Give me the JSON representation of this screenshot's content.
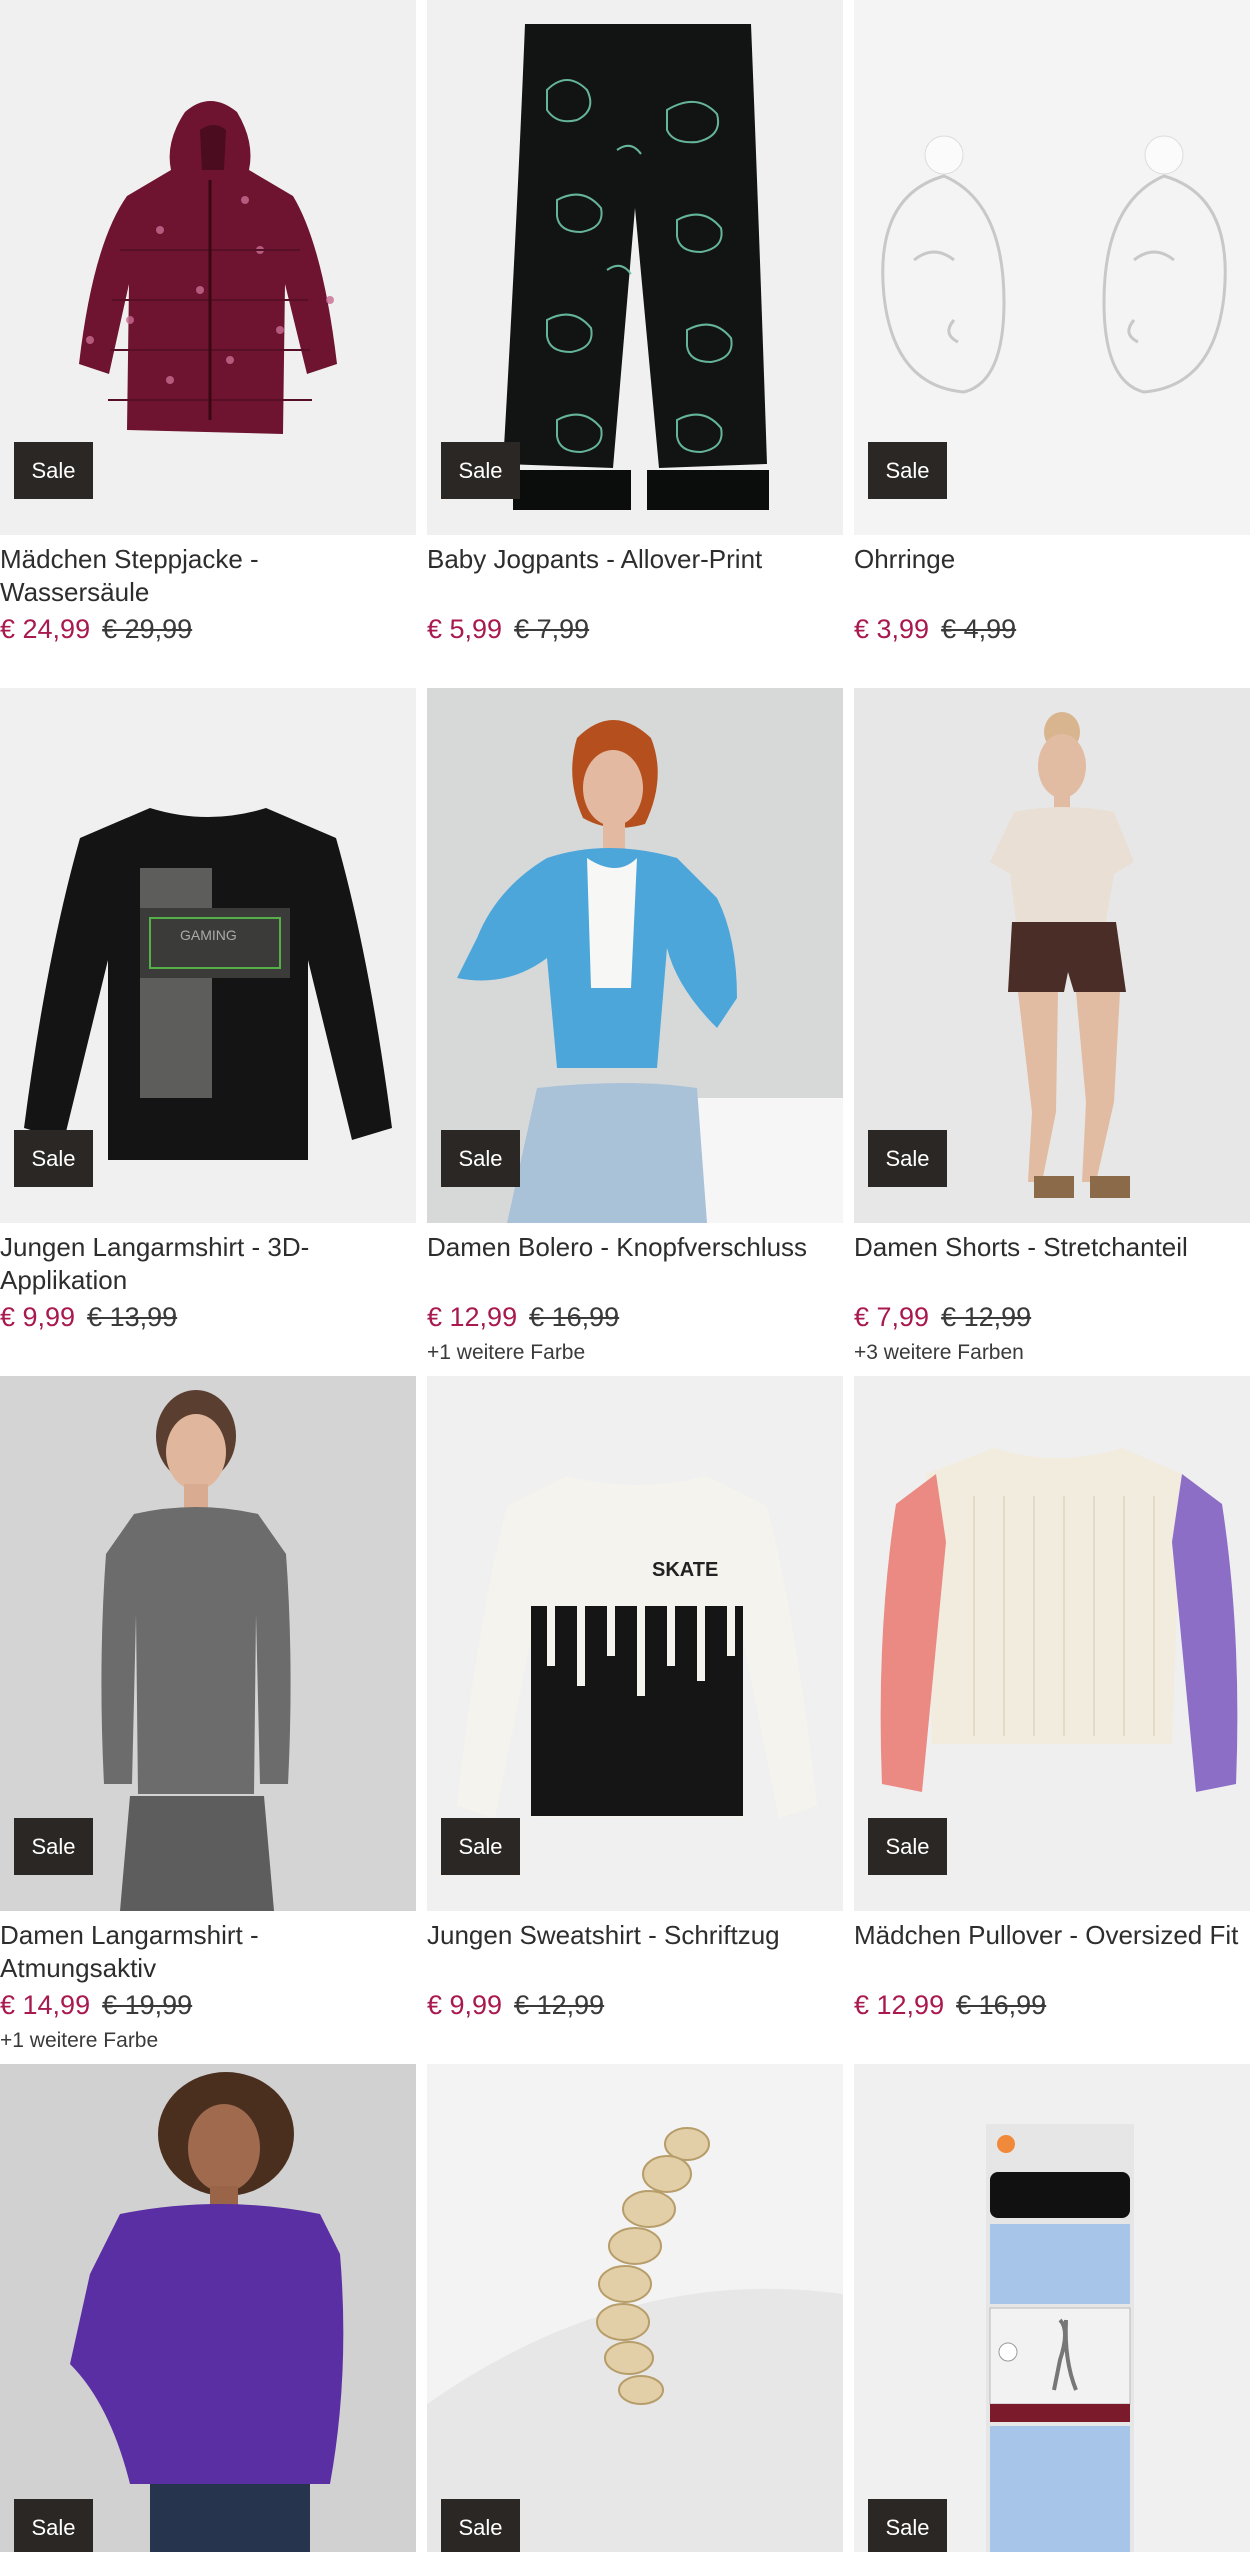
{
  "sale_label": "Sale",
  "products": [
    {
      "title": "Mädchen Steppjacke - Wassersäule",
      "price": "€ 24,99",
      "old_price": "€ 29,99",
      "colors": "",
      "image": "puffer-jacket"
    },
    {
      "title": "Baby Jogpants - Allover-Print",
      "price": "€ 5,99",
      "old_price": "€ 7,99",
      "colors": "",
      "image": "dino-pants"
    },
    {
      "title": "Ohrringe",
      "price": "€ 3,99",
      "old_price": "€ 4,99",
      "colors": "",
      "image": "face-earrings"
    },
    {
      "title": "Jungen Langarmshirt - 3D-Applikation",
      "price": "€ 9,99",
      "old_price": "€ 13,99",
      "colors": "",
      "image": "gamer-longsleeve"
    },
    {
      "title": "Damen Bolero - Knopfverschluss",
      "price": "€ 12,99",
      "old_price": "€ 16,99",
      "colors": "+1 weitere Farbe",
      "image": "blue-bolero"
    },
    {
      "title": "Damen Shorts - Stretchanteil",
      "price": "€ 7,99",
      "old_price": "€ 12,99",
      "colors": "+3 weitere Farben",
      "image": "brown-shorts"
    },
    {
      "title": "Damen Langarmshirt - Atmungsaktiv",
      "price": "€ 14,99",
      "old_price": "€ 19,99",
      "colors": "+1 weitere Farbe",
      "image": "grey-longsleeve"
    },
    {
      "title": "Jungen Sweatshirt - Schriftzug",
      "price": "€ 9,99",
      "old_price": "€ 12,99",
      "colors": "",
      "image": "skate-sweatshirt"
    },
    {
      "title": "Mädchen Pullover - Oversized Fit",
      "price": "€ 12,99",
      "old_price": "€ 16,99",
      "colors": "",
      "image": "colorblock-pullover"
    },
    {
      "title": "",
      "price": "",
      "old_price": "",
      "colors": "",
      "image": "purple-shirt"
    },
    {
      "title": "",
      "price": "",
      "old_price": "",
      "colors": "",
      "image": "rope-bracelet"
    },
    {
      "title": "",
      "price": "",
      "old_price": "",
      "colors": "",
      "image": "leggings-pack"
    }
  ]
}
